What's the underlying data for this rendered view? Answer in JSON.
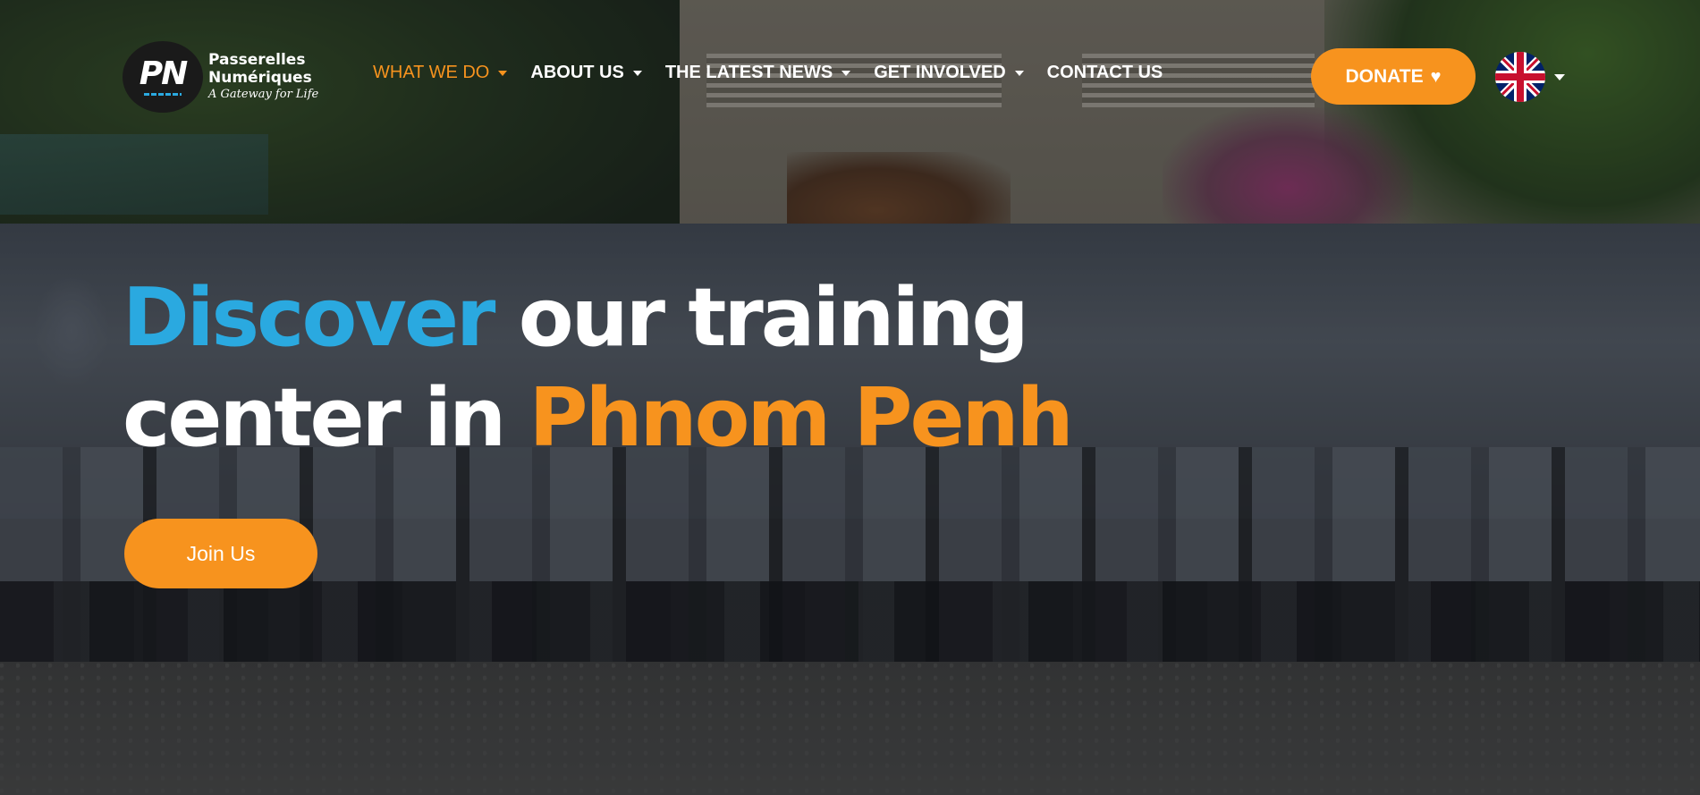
{
  "brand": {
    "logo_mark": "PN",
    "name_line1": "Passerelles",
    "name_line2": "Numériques",
    "tagline": "A Gateway for Life"
  },
  "nav": {
    "items": [
      {
        "label": "WHAT WE DO",
        "has_dropdown": true,
        "active": true
      },
      {
        "label": "ABOUT US",
        "has_dropdown": true,
        "active": false
      },
      {
        "label": "THE LATEST NEWS",
        "has_dropdown": true,
        "active": false
      },
      {
        "label": "GET INVOLVED",
        "has_dropdown": true,
        "active": false
      },
      {
        "label": "CONTACT US",
        "has_dropdown": false,
        "active": false
      }
    ]
  },
  "donate": {
    "label": "DONATE",
    "icon": "heart-icon"
  },
  "language": {
    "icon": "uk-flag-icon",
    "has_dropdown": true
  },
  "hero": {
    "headline_part1": "Discover",
    "headline_part2": " our training",
    "headline_part3": "center in ",
    "headline_part4": "Phnom Penh",
    "cta_label": "Join Us"
  },
  "colors": {
    "accent_orange": "#f7931e",
    "accent_blue": "#2aa9e0",
    "text_white": "#ffffff"
  }
}
